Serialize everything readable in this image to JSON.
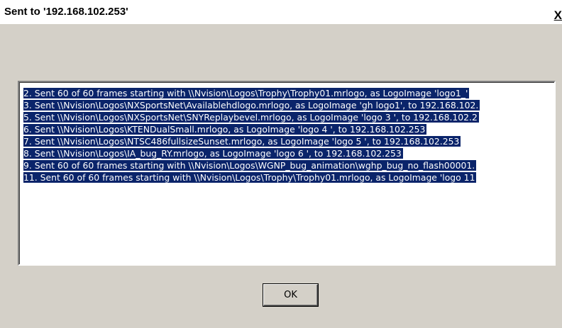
{
  "window": {
    "title": "Sent to '192.168.102.253'",
    "close_label": "X"
  },
  "log": {
    "lines": [
      "2. Sent 60 of 60 frames starting with \\\\Nvision\\Logos\\Trophy\\Trophy01.mrlogo, as LogoImage 'logo1_'",
      "3. Sent \\\\Nvision\\Logos\\NXSportsNet\\Availablehdlogo.mrlogo, as LogoImage 'gh logo1', to 192.168.102.",
      "5. Sent \\\\Nvision\\Logos\\NXSportsNet\\SNYReplaybevel.mrlogo, as LogoImage 'logo 3  ', to 192.168.102.2",
      "6. Sent \\\\Nvision\\Logos\\KTENDualSmall.mrlogo, as LogoImage 'logo 4  ', to 192.168.102.253",
      "7. Sent \\\\Nvision\\Logos\\NTSC486fullsizeSunset.mrlogo, as LogoImage 'logo 5  ', to 192.168.102.253",
      "8. Sent \\\\Nvision\\Logos\\IA_bug_RY.mrlogo, as LogoImage 'logo 6  ', to 192.168.102.253",
      "9. Sent 60 of 60 frames starting with \\\\Nvision\\Logos\\WGNP_bug_animation\\wghp_bug_no_flash00001.",
      "11. Sent 60 of 60 frames starting with \\\\Nvision\\Logos\\Trophy\\Trophy01.mrlogo, as LogoImage 'logo 11"
    ]
  },
  "buttons": {
    "ok_label": "OK"
  },
  "colors": {
    "dialog_bg": "#d4d0c8",
    "selection_bg": "#0a246a",
    "selection_fg": "#ffffff"
  }
}
